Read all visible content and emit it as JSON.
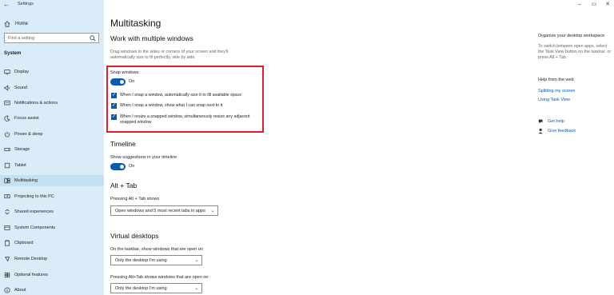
{
  "window": {
    "title": "Settings",
    "back_glyph": "←",
    "minimize_glyph": "–",
    "maximize_glyph": "▭",
    "close_glyph": "✕"
  },
  "sidebar": {
    "home_label": "Home",
    "search_placeholder": "Find a setting",
    "section_label": "System",
    "items": [
      {
        "label": "Display",
        "icon": "display-icon"
      },
      {
        "label": "Sound",
        "icon": "sound-icon"
      },
      {
        "label": "Notifications & actions",
        "icon": "notifications-icon"
      },
      {
        "label": "Focus assist",
        "icon": "focus-assist-icon"
      },
      {
        "label": "Power & sleep",
        "icon": "power-icon"
      },
      {
        "label": "Storage",
        "icon": "storage-icon"
      },
      {
        "label": "Tablet",
        "icon": "tablet-icon"
      },
      {
        "label": "Multitasking",
        "icon": "multitasking-icon",
        "active": true
      },
      {
        "label": "Projecting to this PC",
        "icon": "projecting-icon"
      },
      {
        "label": "Shared experiences",
        "icon": "shared-experiences-icon"
      },
      {
        "label": "System Components",
        "icon": "system-components-icon"
      },
      {
        "label": "Clipboard",
        "icon": "clipboard-icon"
      },
      {
        "label": "Remote Desktop",
        "icon": "remote-desktop-icon"
      },
      {
        "label": "Optional features",
        "icon": "optional-features-icon"
      },
      {
        "label": "About",
        "icon": "about-icon"
      }
    ]
  },
  "main": {
    "title": "Multitasking",
    "work_section": {
      "heading": "Work with multiple windows",
      "description": "Drag windows to the sides or corners of your screen and they'll automatically size to fit perfectly, side by side.",
      "snap_label": "Snap windows",
      "snap_state": "On",
      "checkboxes": [
        {
          "label": "When I snap a window, automatically size it to fill available space",
          "checked": true
        },
        {
          "label": "When I snap a window, show what I can snap next to it",
          "checked": true
        },
        {
          "label": "When I resize a snapped window, simultaneously resize any adjacent snapped window",
          "checked": true
        }
      ]
    },
    "timeline": {
      "heading": "Timeline",
      "label": "Show suggestions in your timeline",
      "state": "On"
    },
    "alt_tab": {
      "heading": "Alt + Tab",
      "label": "Pressing Alt + Tab shows",
      "value": "Open windows and 5 most recent tabs in apps"
    },
    "virtual_desktops": {
      "heading": "Virtual desktops",
      "taskbar_label": "On the taskbar, show windows that are open on",
      "taskbar_value": "Only the desktop I'm using",
      "alttab_label": "Pressing Alt+Tab shows windows that are open on",
      "alttab_value": "Only the desktop I'm using"
    },
    "check_glyph": "✓",
    "chevron_glyph": "⌄"
  },
  "right": {
    "title": "Organize your desktop workspace",
    "description": "To switch between open apps, select the Task View button on the taskbar, or press Alt + Tab.",
    "help_title": "Help from the web",
    "links": [
      "Splitting my screen",
      "Using Task View"
    ],
    "get_help": "Get help",
    "give_feedback": "Give feedback"
  },
  "colors": {
    "accent": "#0a5aa8",
    "sidebar_bg": "#d9ecf7",
    "highlight": "#d8222a"
  }
}
